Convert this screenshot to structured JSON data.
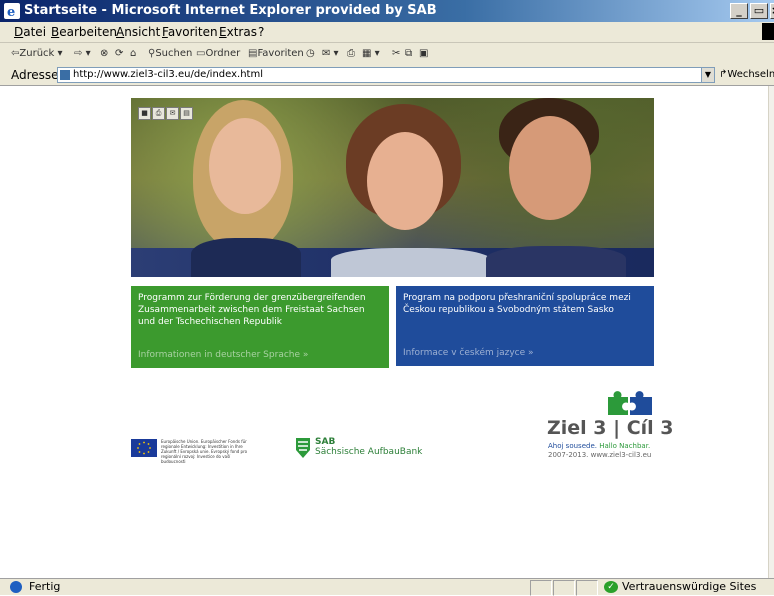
{
  "window": {
    "title": "Startseite - Microsoft Internet Explorer provided by SAB"
  },
  "menubar": {
    "items": [
      "Datei",
      "Bearbeiten",
      "Ansicht",
      "Favoriten",
      "Extras",
      "?"
    ]
  },
  "toolbar": {
    "back": "Zurück",
    "search": "Suchen",
    "folders": "Ordner",
    "favorites": "Favoriten"
  },
  "addressbar": {
    "label": "Adresse",
    "url": "http://www.ziel3-cil3.eu/de/index.html",
    "go_label": "Wechseln z"
  },
  "content": {
    "box_de": {
      "text": "Programm zur Förderung der grenzübergreifenden Zusammenarbeit zwischen dem Freistaat Sachsen und der Tschechischen Republik",
      "link": "Informationen in deutscher Sprache »"
    },
    "box_cz": {
      "text": "Program na podporu přeshraniční spolupráce mezi Českou republikou a Svobodným státem Sasko",
      "link": "Informace v českém jazyce »"
    },
    "eu_text": "Europäische Union. Europäischer Fonds für regionale Entwicklung: Investition in Ihre Zukunft / Evropská unie. Evropský fond pro regionální rozvoj: Investice do vaší budoucnosti",
    "sab_title": "SAB",
    "sab_subtitle": "Sächsische AufbauBank",
    "ziel_title": "Ziel 3 | Cíl 3",
    "ziel_greeting_cz": "Ahoj sousede.",
    "ziel_greeting_de": "Hallo Nachbar.",
    "ziel_footer": "2007-2013. www.ziel3-cil3.eu"
  },
  "statusbar": {
    "status": "Fertig",
    "zone": "Vertrauenswürdige Sites"
  },
  "colors": {
    "green_box": "#3c9a2e",
    "blue_box": "#1f4c9b",
    "ziel_green": "#2c9a3a",
    "ziel_blue": "#1f4c9b"
  }
}
